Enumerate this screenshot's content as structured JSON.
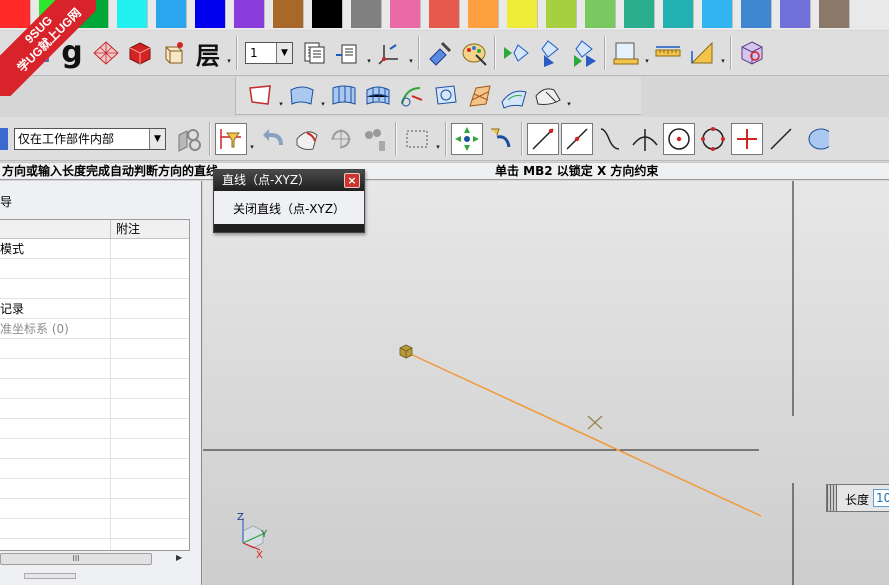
{
  "palette": {
    "colors": [
      "#ff2a2a",
      "#2ee62e",
      "#00a83a",
      "#23f0f0",
      "#2aa6ee",
      "#0000ee",
      "#8a3cdc",
      "#a8682a",
      "#000000",
      "#808080",
      "#ea6aa8",
      "#e65a4e",
      "#ffa040",
      "#f0ec3a",
      "#a6d040",
      "#7ac860",
      "#2aae8e",
      "#22b0b0",
      "#32b4f0",
      "#3e86d0",
      "#7070d8",
      "#8a7868"
    ]
  },
  "watermark": {
    "line1": "9SUG",
    "line2": "学UG就上UG网"
  },
  "toolbar_top": {
    "layer_value": "1",
    "layer_icon": "层"
  },
  "selection_bar": {
    "scope_value": "仅在工作部件内部"
  },
  "cue": {
    "left": "方向或输入长度完成自动判断方向的直线",
    "right": "单击 MB2 以锁定 X 方向约束"
  },
  "navigator": {
    "title": "导",
    "column_note": "附注",
    "rows": [
      {
        "label": "模式",
        "dim": false
      },
      {
        "label": "",
        "dim": false
      },
      {
        "label": "",
        "dim": false
      },
      {
        "label": "记录",
        "dim": false
      },
      {
        "label": "准坐标系 (0)",
        "dim": true
      },
      {
        "label": "",
        "dim": false
      },
      {
        "label": "",
        "dim": false
      },
      {
        "label": "",
        "dim": false
      },
      {
        "label": "",
        "dim": false
      },
      {
        "label": "",
        "dim": false
      },
      {
        "label": "",
        "dim": false
      },
      {
        "label": "",
        "dim": false
      },
      {
        "label": "",
        "dim": false
      },
      {
        "label": "",
        "dim": false
      },
      {
        "label": "",
        "dim": false
      },
      {
        "label": "",
        "dim": false
      }
    ],
    "scroll_grip": "III"
  },
  "dialog": {
    "title": "直线（点-XYZ）",
    "close_glyph": "×",
    "button_label": "关闭直线（点-XYZ）"
  },
  "length_input": {
    "label": "长度",
    "value": "10"
  },
  "triad": {
    "z": "Z",
    "y": "Y",
    "x": "X"
  },
  "colors": {
    "preview_line": "#f29a3a",
    "cue_bg": "#eef0f2",
    "dialog_title_bg": "#2a2a2a"
  }
}
